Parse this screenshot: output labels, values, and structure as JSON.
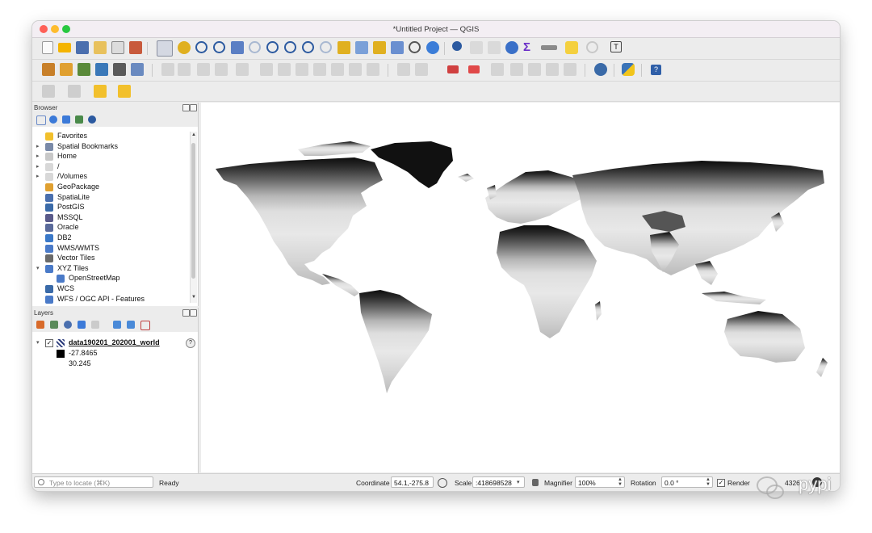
{
  "window": {
    "title": "*Untitled Project — QGIS"
  },
  "browser": {
    "title": "Browser",
    "items": [
      {
        "label": "Favorites",
        "icon": "star-icon",
        "expand": ""
      },
      {
        "label": "Spatial Bookmarks",
        "icon": "bookmark-icon",
        "expand": "▸"
      },
      {
        "label": "Home",
        "icon": "home-folder-icon",
        "expand": "▸"
      },
      {
        "label": "/",
        "icon": "folder-icon",
        "expand": "▸"
      },
      {
        "label": "/Volumes",
        "icon": "folder-icon",
        "expand": "▸"
      },
      {
        "label": "GeoPackage",
        "icon": "geopackage-icon",
        "expand": ""
      },
      {
        "label": "SpatiaLite",
        "icon": "spatialite-icon",
        "expand": ""
      },
      {
        "label": "PostGIS",
        "icon": "postgis-icon",
        "expand": ""
      },
      {
        "label": "MSSQL",
        "icon": "mssql-icon",
        "expand": ""
      },
      {
        "label": "Oracle",
        "icon": "oracle-icon",
        "expand": ""
      },
      {
        "label": "DB2",
        "icon": "db2-icon",
        "expand": ""
      },
      {
        "label": "WMS/WMTS",
        "icon": "wms-icon",
        "expand": ""
      },
      {
        "label": "Vector Tiles",
        "icon": "vector-tiles-icon",
        "expand": ""
      },
      {
        "label": "XYZ Tiles",
        "icon": "xyz-tiles-icon",
        "expand": "▾"
      },
      {
        "label": "OpenStreetMap",
        "icon": "grid-icon",
        "expand": ""
      },
      {
        "label": "WCS",
        "icon": "wcs-icon",
        "expand": ""
      },
      {
        "label": "WFS / OGC API - Features",
        "icon": "wfs-icon",
        "expand": ""
      }
    ]
  },
  "layers": {
    "title": "Layers",
    "layer_name": "data190201_202001_world",
    "legend_min": "-27.8465",
    "legend_max": "30.245",
    "help": "?"
  },
  "status": {
    "locate_placeholder": "Type to locate (⌘K)",
    "ready": "Ready",
    "coordinate_label": "Coordinate",
    "coordinate_value": "54.1,-275.8",
    "scale_label": "Scale",
    "scale_value": ":418698528",
    "magnifier_label": "Magnifier",
    "magnifier_value": "100%",
    "rotation_label": "Rotation",
    "rotation_value": "0.0 °",
    "render_label": "Render",
    "epsg_value": "4326"
  },
  "watermark": {
    "text": "pypi"
  },
  "colors": {
    "titlebar": "#f3eef3",
    "chrome": "#ececec",
    "map_dark": "#0a0a0a",
    "map_light": "#f2f2f2"
  }
}
